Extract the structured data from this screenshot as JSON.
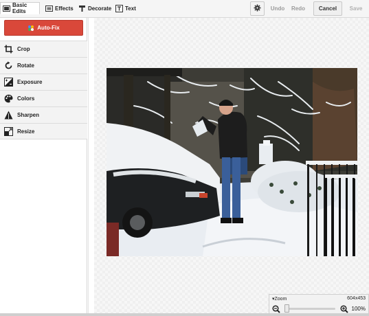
{
  "toolbar": {
    "tabs": [
      {
        "label": "Basic Edits",
        "icon": "wand-icon"
      },
      {
        "label": "Effects",
        "icon": "film-icon"
      },
      {
        "label": "Decorate",
        "icon": "brush-icon"
      },
      {
        "label": "Text",
        "icon": "text-icon"
      }
    ],
    "settings_icon": "gear-icon",
    "undo_label": "Undo",
    "redo_label": "Redo",
    "cancel_label": "Cancel",
    "save_label": "Save"
  },
  "sidebar": {
    "autofix_label": "Auto-Fix",
    "autofix_color": "#d9483a",
    "tools": [
      {
        "label": "Crop",
        "icon": "crop-icon"
      },
      {
        "label": "Rotate",
        "icon": "rotate-icon"
      },
      {
        "label": "Exposure",
        "icon": "exposure-icon"
      },
      {
        "label": "Colors",
        "icon": "palette-icon"
      },
      {
        "label": "Sharpen",
        "icon": "sharpen-icon"
      },
      {
        "label": "Resize",
        "icon": "resize-icon"
      }
    ]
  },
  "zoom": {
    "label": "Zoom",
    "dimensions": "604x453",
    "percent": "100%",
    "slider_value": 0
  }
}
